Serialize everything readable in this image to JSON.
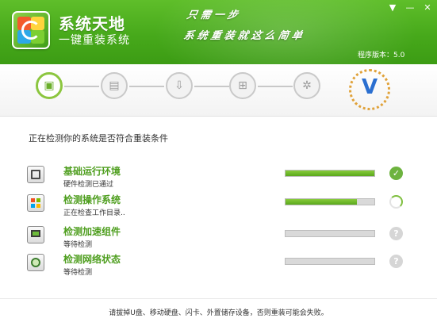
{
  "header": {
    "app_title": "系统天地",
    "app_subtitle": "一键重装系统",
    "slogan_line1": "只需一步",
    "slogan_line2": "系统重装就这么简单",
    "version": "程序版本：5.0",
    "menu_icon": "dropdown-arrow-icon",
    "minimize_icon": "minimize-icon",
    "close_icon": "close-icon",
    "colors": {
      "green_top": "#5fbe2a",
      "green_bottom": "#3c9c14"
    }
  },
  "steps": [
    {
      "icon": "environment-check-icon",
      "active": true
    },
    {
      "icon": "file-select-icon",
      "active": false
    },
    {
      "icon": "download-icon",
      "active": false
    },
    {
      "icon": "windows-install-icon",
      "active": false
    },
    {
      "icon": "gear-finish-icon",
      "active": false
    }
  ],
  "badge_icon": "v-badge-wreath-icon",
  "detect_label": "正在检测你的系统是否符合重装条件",
  "checks": [
    {
      "icon": "server-icon",
      "title": "基础运行环境",
      "status": "硬件检测已通过",
      "progress": 1.0,
      "state": "ok"
    },
    {
      "icon": "windows-icon",
      "title": "检测操作系统",
      "status": "正在检查工作目录..",
      "progress": 0.8,
      "state": "loading"
    },
    {
      "icon": "monitor-icon",
      "title": "检测加速组件",
      "status": "等待检测",
      "progress": 0,
      "state": "pending"
    },
    {
      "icon": "globe-icon",
      "title": "检测网络状态",
      "status": "等待检测",
      "progress": 0,
      "state": "pending"
    }
  ],
  "footer_note": "请拔掉U盘、移动硬盘、闪卡、外置储存设备，否则重装可能会失败。",
  "accent": "#6db33f"
}
